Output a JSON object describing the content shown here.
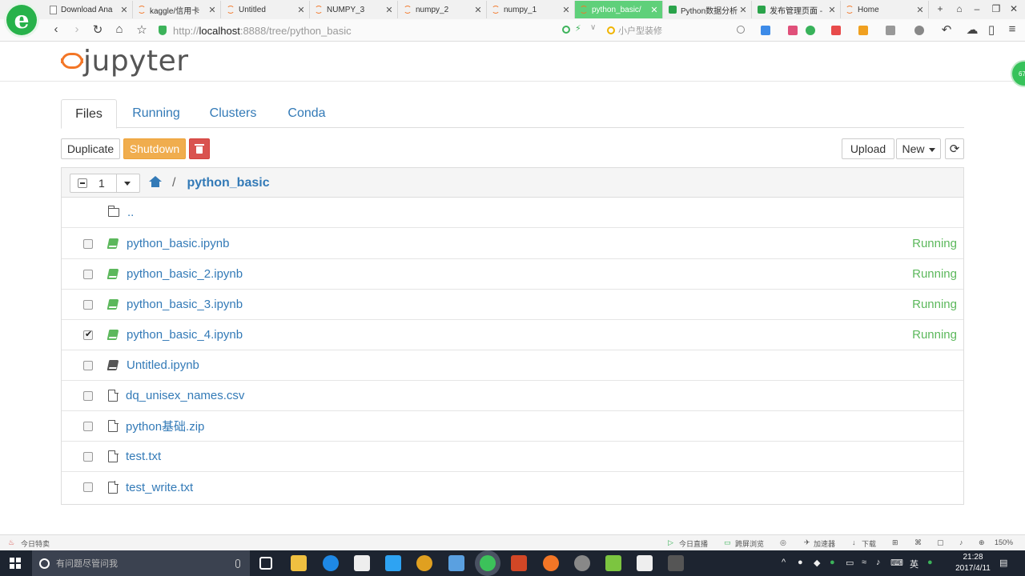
{
  "browser": {
    "tabs": [
      {
        "label": "Download Ana",
        "icon": "page",
        "active": false
      },
      {
        "label": "kaggle/信用卡",
        "icon": "jup",
        "active": false
      },
      {
        "label": "Untitled",
        "icon": "jup",
        "active": false
      },
      {
        "label": "NUMPY_3",
        "icon": "jup",
        "active": false
      },
      {
        "label": "numpy_2",
        "icon": "jup",
        "active": false
      },
      {
        "label": "numpy_1",
        "icon": "jup",
        "active": false
      },
      {
        "label": "python_basic/",
        "icon": "jup",
        "active": true
      },
      {
        "label": "Python数据分析",
        "icon": "green",
        "active": false
      },
      {
        "label": "发布管理页面 -",
        "icon": "green",
        "active": false
      },
      {
        "label": "Home",
        "icon": "jup",
        "active": false
      }
    ],
    "url_scheme": "http://",
    "url_host": "localhost",
    "url_rest": ":8888/tree/python_basic",
    "search_placeholder": "小户型装修",
    "side_bubble": "67"
  },
  "jupyter": {
    "logo_text": "jupyter",
    "tabs": [
      "Files",
      "Running",
      "Clusters",
      "Conda"
    ],
    "active_tab": "Files",
    "toolbar": {
      "duplicate": "Duplicate",
      "shutdown": "Shutdown",
      "upload": "Upload",
      "new": "New"
    },
    "selected_count": "1",
    "breadcrumb_sep": "/",
    "current_dir": "python_basic",
    "up_dir": "..",
    "files": [
      {
        "name": "python_basic.ipynb",
        "type": "notebook-running",
        "status": "Running",
        "checked": false
      },
      {
        "name": "python_basic_2.ipynb",
        "type": "notebook-running",
        "status": "Running",
        "checked": false
      },
      {
        "name": "python_basic_3.ipynb",
        "type": "notebook-running",
        "status": "Running",
        "checked": false
      },
      {
        "name": "python_basic_4.ipynb",
        "type": "notebook-running",
        "status": "Running",
        "checked": true
      },
      {
        "name": "Untitled.ipynb",
        "type": "notebook",
        "status": "",
        "checked": false
      },
      {
        "name": "dq_unisex_names.csv",
        "type": "file",
        "status": "",
        "checked": false
      },
      {
        "name": "python基础.zip",
        "type": "file",
        "status": "",
        "checked": false
      },
      {
        "name": "test.txt",
        "type": "file",
        "status": "",
        "checked": false
      },
      {
        "name": "test_write.txt",
        "type": "file",
        "status": "",
        "checked": false
      }
    ]
  },
  "statusbar": {
    "left": "今日特卖",
    "live": "今日直播",
    "browse": "跨屏浏览",
    "accel": "加速器",
    "download": "下载",
    "zoom": "150%"
  },
  "taskbar": {
    "search_placeholder": "有问题尽管问我",
    "ime": "英",
    "time": "21:28",
    "date": "2017/4/11"
  }
}
